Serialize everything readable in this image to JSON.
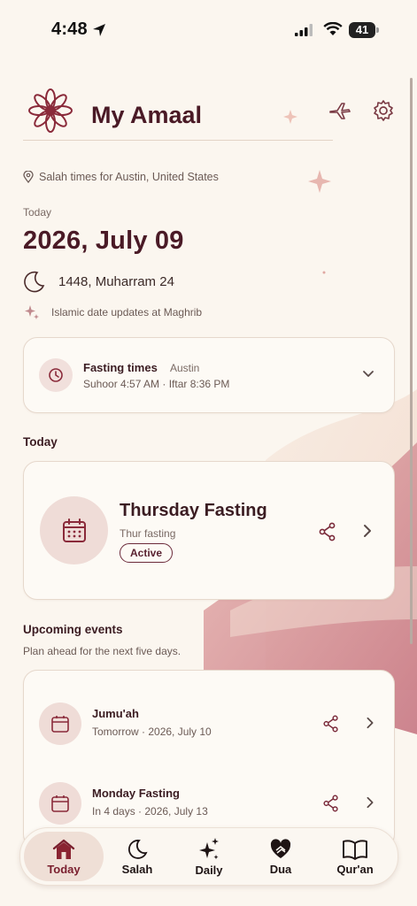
{
  "status_bar": {
    "time": "4:48",
    "battery": "41"
  },
  "header": {
    "title": "My Amaal"
  },
  "location": {
    "text": "Salah times for Austin, United States"
  },
  "date": {
    "today_label": "Today",
    "gregorian": "2026, July 09",
    "hijri": "1448, Muharram 24",
    "maghrib_note": "Islamic date updates at Maghrib"
  },
  "fasting_card": {
    "title": "Fasting times",
    "city": "Austin",
    "times": "Suhoor 4:57 AM · Iftar 8:36 PM"
  },
  "today_section": {
    "heading": "Today",
    "event": {
      "title": "Thursday Fasting",
      "subtitle": "Thur fasting",
      "badge": "Active"
    }
  },
  "upcoming": {
    "heading": "Upcoming events",
    "subtitle": "Plan ahead for the next five days.",
    "items": [
      {
        "title": "Jumu'ah",
        "subtitle": "Tomorrow · 2026, July 10"
      },
      {
        "title": "Monday Fasting",
        "subtitle": "In 4 days · 2026, July 13"
      }
    ]
  },
  "tabs": [
    {
      "label": "Today",
      "icon": "home-icon"
    },
    {
      "label": "Salah",
      "icon": "moon-icon"
    },
    {
      "label": "Daily",
      "icon": "sparkle-icon"
    },
    {
      "label": "Dua",
      "icon": "heart-hands-icon"
    },
    {
      "label": "Qur'an",
      "icon": "book-icon"
    }
  ],
  "colors": {
    "accent": "#7a1f2e",
    "background": "#fbf6ef",
    "card": "#fdfaf5"
  }
}
